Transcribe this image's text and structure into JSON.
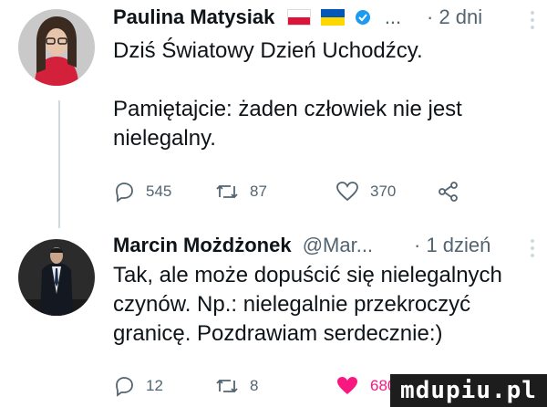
{
  "tweets": [
    {
      "author_name": "Paulina Matysiak",
      "flag_icon": "poland-flag-icon",
      "flag_colors": [
        "#dc143c",
        "#ffffff"
      ],
      "flag2_icon": "ukraine-flag-icon",
      "flag2_colors": [
        "#0057b7",
        "#ffd700"
      ],
      "verified_icon": "verified-badge-icon",
      "handle": "...",
      "time": "· 2 dni",
      "text": "Dziś Światowy Dzień Uchodźcy.\n\nPamiętajcie: żaden człowiek nie jest\nnielegalny.",
      "reply_count": "545",
      "retweet_count": "87",
      "like_count": "370",
      "liked": false,
      "avatar_colors": {
        "bg": "#c9c9c9",
        "hair": "#3b2a20",
        "skin": "#e8c4aa",
        "shirt": "#d4213b"
      }
    },
    {
      "author_name": "Marcin Możdżonek",
      "handle": "@Mar...",
      "time": "· 1 dzień",
      "text": "Tak, ale może dopuścić się nielegalnych\nczynów. Np.: nielegalnie przekroczyć\ngranicę. Pozdrawiam serdecznie:)",
      "reply_count": "12",
      "retweet_count": "8",
      "like_count": "680",
      "liked": true,
      "avatar_colors": {
        "bg": "#2b2b2b",
        "suit": "#141820",
        "shirt": "#e9ecef",
        "skin": "#c9a58c"
      }
    }
  ],
  "watermark": "mdupiu.pl",
  "colors": {
    "accent_like": "#f91880",
    "muted": "#536471",
    "line": "#cfd9de",
    "verified": "#1d9bf0"
  }
}
